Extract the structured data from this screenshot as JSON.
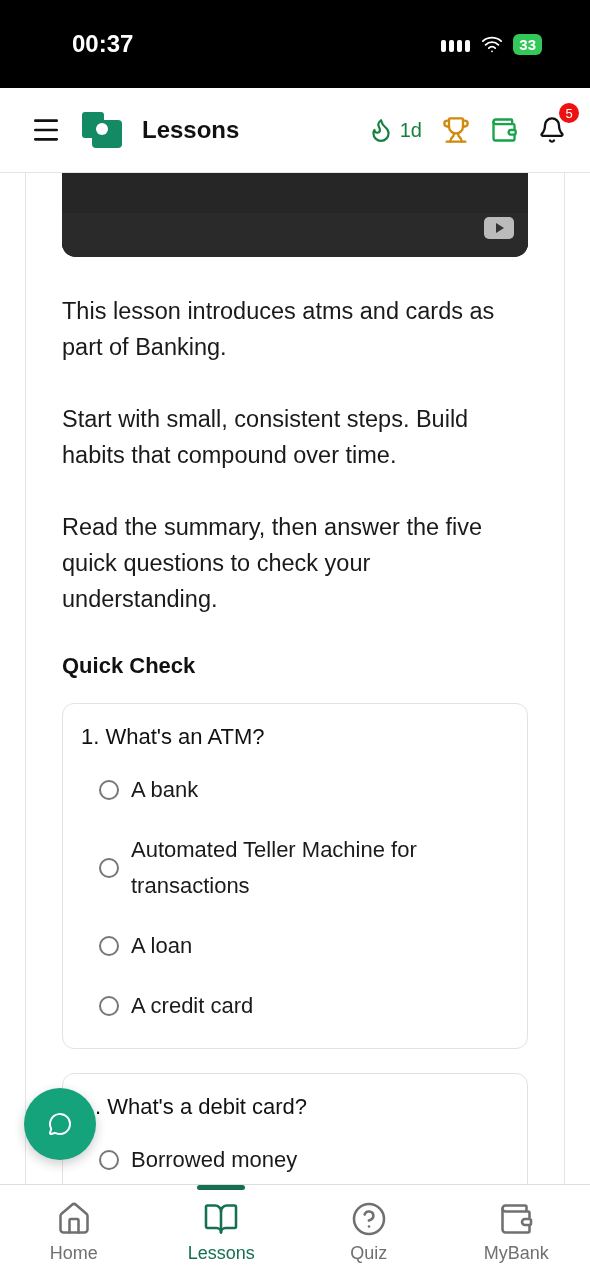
{
  "status_bar": {
    "time": "00:37",
    "battery": "33"
  },
  "header": {
    "title": "Lessons",
    "streak": "1d",
    "notifications": "5"
  },
  "lesson": {
    "video": {
      "kind": "picture"
    },
    "paragraphs": [
      "This lesson introduces atms and cards as part of Banking.",
      "Start with small, consistent steps. Build habits that compound over time.",
      "Read the summary, then answer the five quick questions to check your understanding."
    ],
    "section_title": "Quick Check",
    "questions": [
      {
        "text": "1. What's an ATM?",
        "options": [
          {
            "label": "A bank",
            "selected": false
          },
          {
            "label": "Automated Teller Machine for transactions",
            "selected": false
          },
          {
            "label": "A loan",
            "selected": false
          },
          {
            "label": "A credit card",
            "selected": false
          }
        ]
      },
      {
        "text": ". What's a debit card?",
        "options": [
          {
            "label": "Borrowed money",
            "selected": false
          }
        ]
      }
    ]
  },
  "bottom_nav": [
    {
      "label": "Home",
      "selected": false
    },
    {
      "label": "Lessons",
      "selected": true
    },
    {
      "label": "Quiz",
      "selected": false
    },
    {
      "label": "MyBank",
      "selected": false
    }
  ]
}
